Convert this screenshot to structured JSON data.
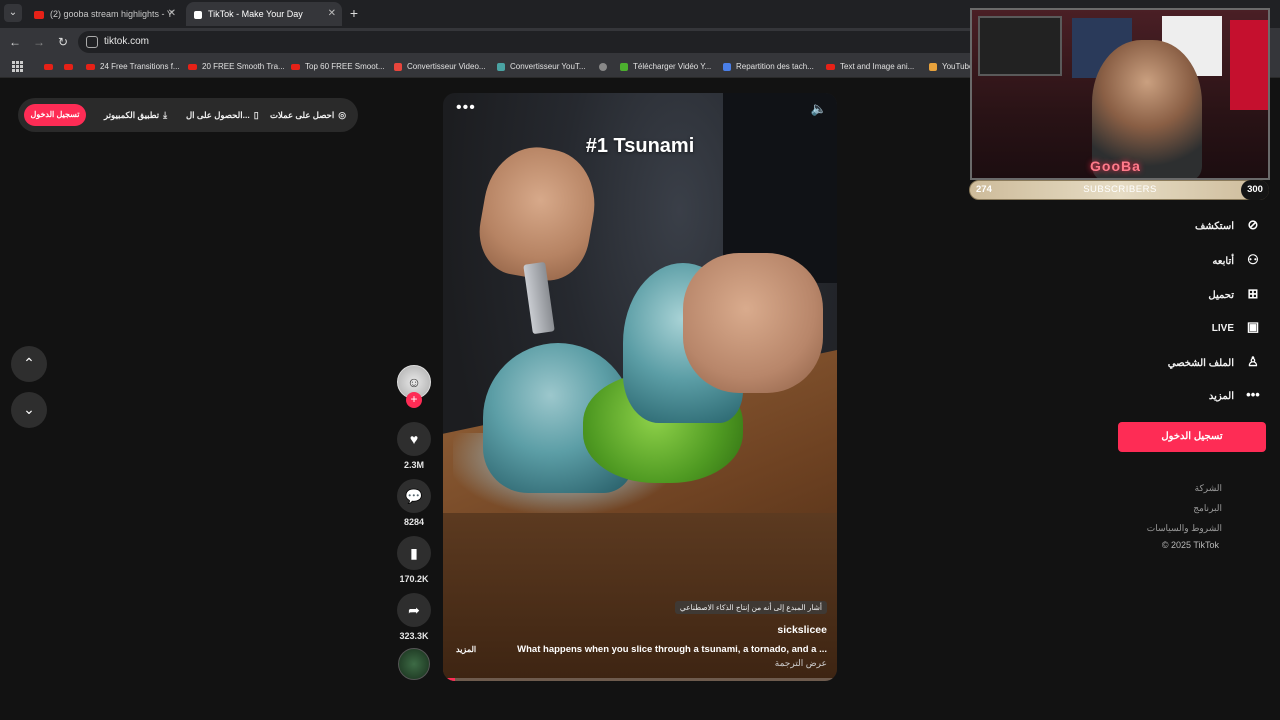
{
  "browser": {
    "tabs": [
      {
        "title": "(2) gooba stream highlights - Y"
      },
      {
        "title": "TikTok - Make Your Day"
      }
    ],
    "url": "tiktok.com",
    "bookmarks": [
      {
        "label": "",
        "icon": "youtube-icon"
      },
      {
        "label": "",
        "icon": "youtube-icon"
      },
      {
        "label": "24 Free Transitions f...",
        "icon": "youtube-icon"
      },
      {
        "label": "20 FREE Smooth Tra...",
        "icon": "youtube-icon"
      },
      {
        "label": "Top 60 FREE Smoot...",
        "icon": "youtube-icon"
      },
      {
        "label": "Convertisseur Video...",
        "icon": "converter-icon"
      },
      {
        "label": "Convertisseur YouT...",
        "icon": "converter-icon"
      },
      {
        "label": "",
        "icon": "globe-icon"
      },
      {
        "label": "Télécharger Vidéo Y...",
        "icon": "download-icon"
      },
      {
        "label": "Repartition des tach...",
        "icon": "docs-icon"
      },
      {
        "label": "Text and Image ani...",
        "icon": "youtube-icon"
      },
      {
        "label": "YouTube",
        "icon": "star-icon"
      }
    ]
  },
  "topbar": {
    "login": "تسجيل الدخول",
    "desktop_app": "تطبيق الكمبيوتر",
    "get_app": "الحصول على ال...",
    "coins": "احصل على عملات"
  },
  "video": {
    "title": "#1 Tsunami",
    "ai_label": "أشار المبدع إلى أنه من إنتاج الذكاء الاصطناعي",
    "author": "sickslicee",
    "caption": "What happens when you slice through a tsunami, a tornado, and a ...",
    "more": "المزيد",
    "translate": "عرض الترجمة",
    "progress_percent": 3
  },
  "actions": {
    "likes": "2.3M",
    "comments": "8284",
    "saves": "170.2K",
    "shares": "323.3K"
  },
  "stream_overlay": {
    "brand": "GooBa",
    "subs_current": "274",
    "subs_label": "SUBSCRIBERS",
    "subs_goal": "300"
  },
  "sidebar": {
    "items": [
      {
        "label": "استكشف",
        "icon": "compass-icon"
      },
      {
        "label": "أتابعه",
        "icon": "following-icon"
      },
      {
        "label": "تحميل",
        "icon": "upload-icon"
      },
      {
        "label": "LIVE",
        "icon": "live-icon"
      },
      {
        "label": "الملف الشخصي",
        "icon": "profile-icon"
      },
      {
        "label": "المزيد",
        "icon": "more-icon"
      }
    ],
    "login": "تسجيل الدخول",
    "footer": [
      "الشركة",
      "البرنامج",
      "الشروط والسياسات",
      "© 2025 TikTok"
    ]
  },
  "colors": {
    "accent": "#fe2c55",
    "background": "#121212"
  }
}
